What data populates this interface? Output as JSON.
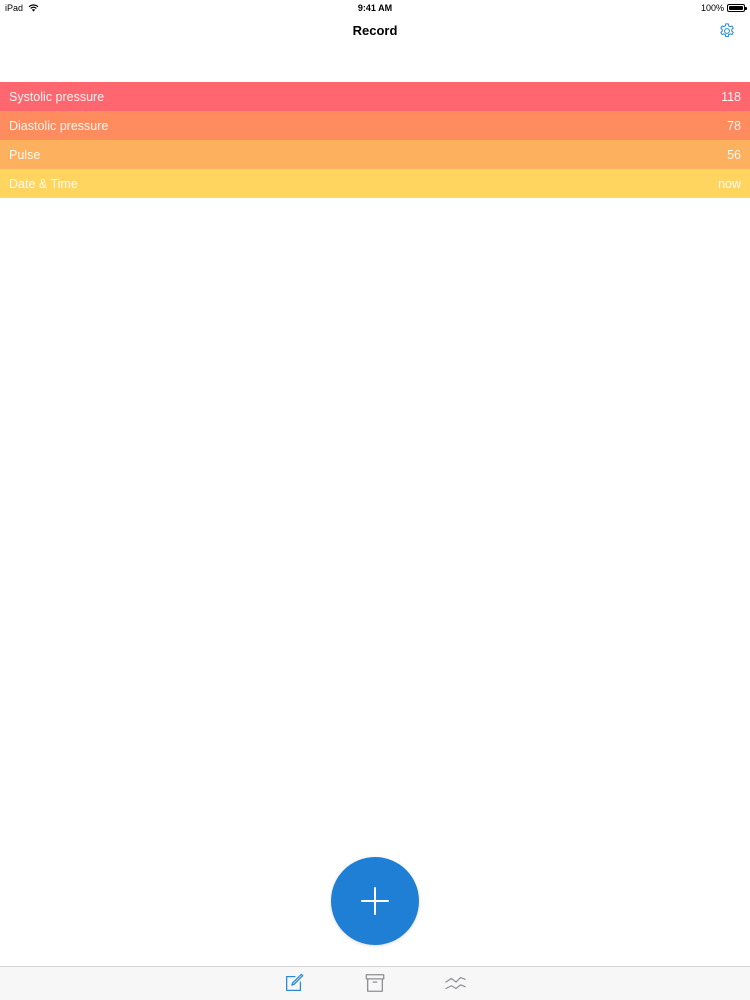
{
  "status_bar": {
    "device": "iPad",
    "time": "9:41 AM",
    "battery": "100%"
  },
  "nav": {
    "title": "Record",
    "settings_icon": "gear-icon"
  },
  "fields": [
    {
      "label": "Systolic pressure",
      "value": "118",
      "color": "#ff6670"
    },
    {
      "label": "Diastolic pressure",
      "value": "78",
      "color": "#ff8c5e"
    },
    {
      "label": "Pulse",
      "value": "56",
      "color": "#fdb05e"
    },
    {
      "label": "Date & Time",
      "value": "now",
      "color": "#ffd560"
    }
  ],
  "fab": {
    "icon": "plus-icon",
    "color": "#1f7fd4"
  },
  "tabs": [
    {
      "icon": "compose-icon",
      "active": true
    },
    {
      "icon": "archive-box-icon",
      "active": false
    },
    {
      "icon": "trend-lines-icon",
      "active": false
    }
  ],
  "colors": {
    "accent": "#2a8bd9",
    "inactive": "#8e8e93"
  }
}
